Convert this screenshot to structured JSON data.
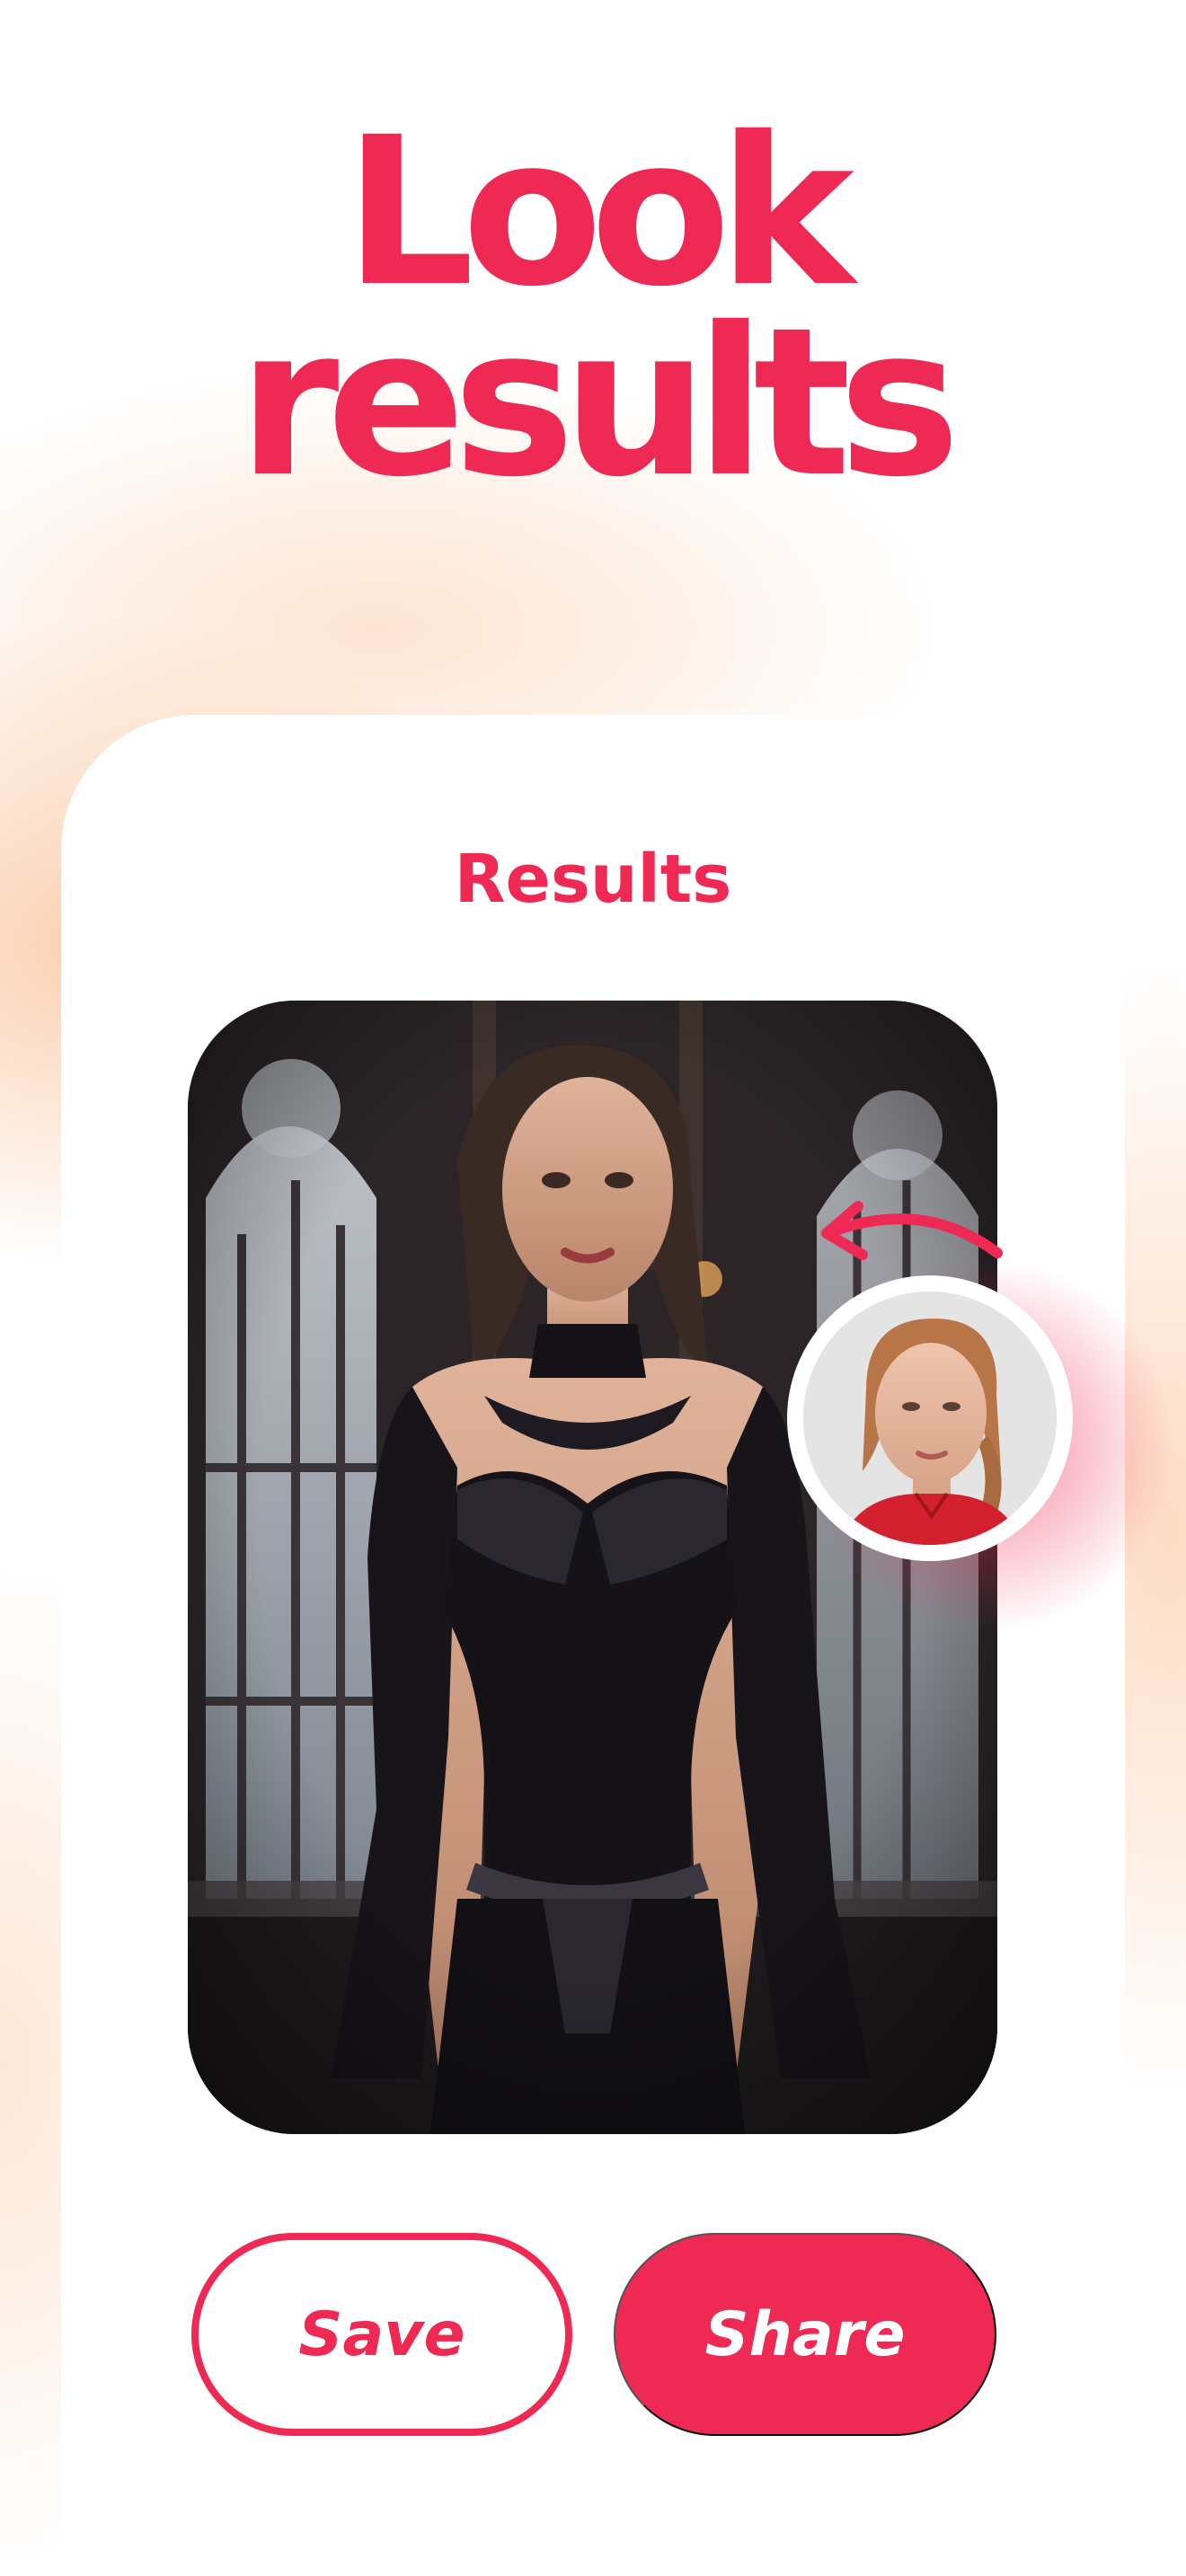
{
  "hero": {
    "line1": "Look",
    "line2": "results"
  },
  "card": {
    "title": "Results"
  },
  "buttons": {
    "save_label": "Save",
    "share_label": "Share"
  },
  "colors": {
    "accent": "#ee2a54",
    "background_glow": "#fac6a0",
    "card": "#ffffff"
  },
  "icons": {
    "arrow": "curved-arrow-left-icon"
  }
}
